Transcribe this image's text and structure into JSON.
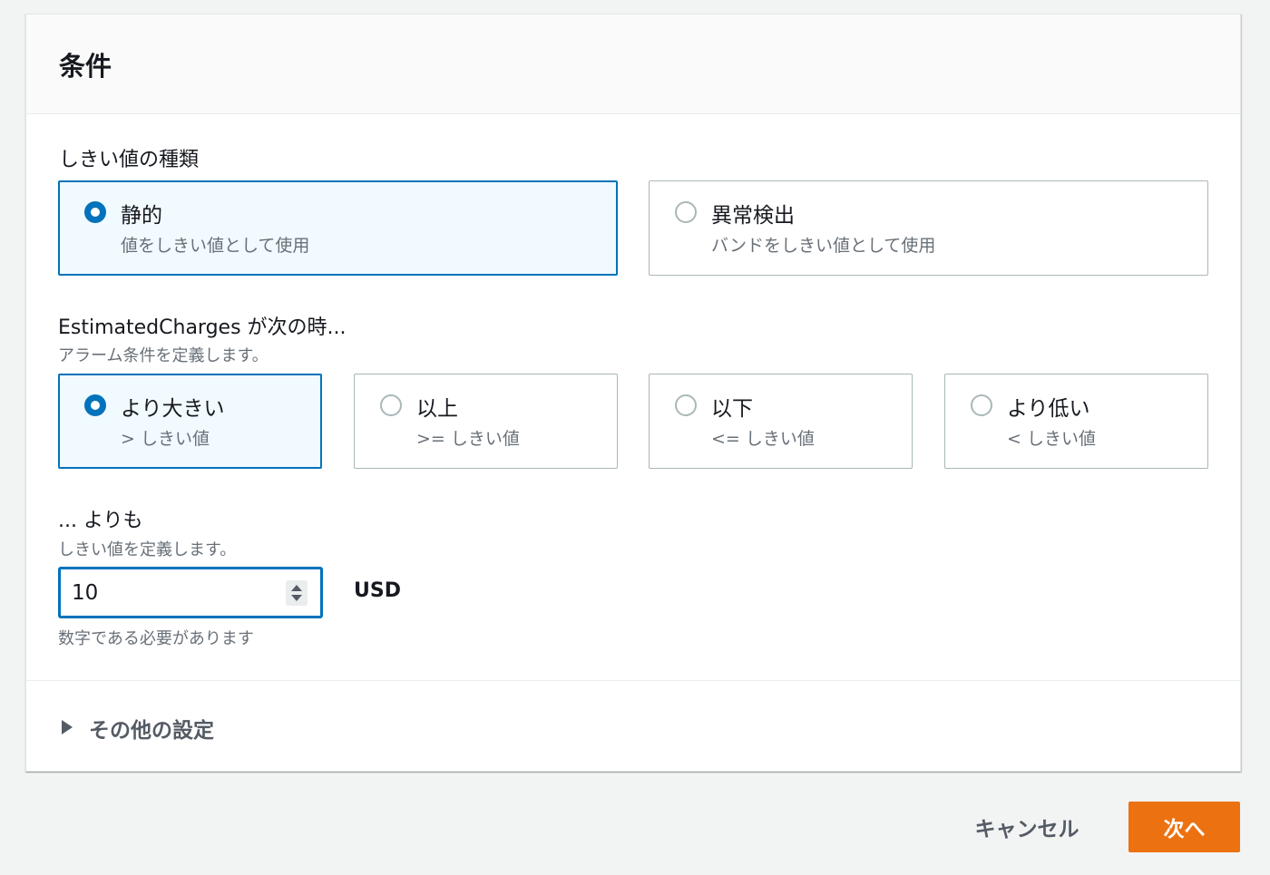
{
  "panel": {
    "title": "条件"
  },
  "threshold_type": {
    "label": "しきい値の種類",
    "options": [
      {
        "title": "静的",
        "subtitle": "値をしきい値として使用",
        "selected": true
      },
      {
        "title": "異常検出",
        "subtitle": "バンドをしきい値として使用",
        "selected": false
      }
    ]
  },
  "condition": {
    "label": "EstimatedCharges が次の時...",
    "description": "アラーム条件を定義します。",
    "options": [
      {
        "title": "より大きい",
        "subtitle": "> しきい値",
        "selected": true
      },
      {
        "title": "以上",
        "subtitle": ">= しきい値",
        "selected": false
      },
      {
        "title": "以下",
        "subtitle": "<= しきい値",
        "selected": false
      },
      {
        "title": "より低い",
        "subtitle": "< しきい値",
        "selected": false
      }
    ]
  },
  "threshold": {
    "label": "... よりも",
    "description": "しきい値を定義します。",
    "value": "10",
    "unit": "USD",
    "hint": "数字である必要があります"
  },
  "additional_settings": {
    "label": "その他の設定"
  },
  "footer": {
    "cancel_label": "キャンセル",
    "next_label": "次へ"
  },
  "colors": {
    "accent": "#0073bb",
    "primary_button": "#ec7211",
    "selected_tile_bg": "#f1faff"
  }
}
